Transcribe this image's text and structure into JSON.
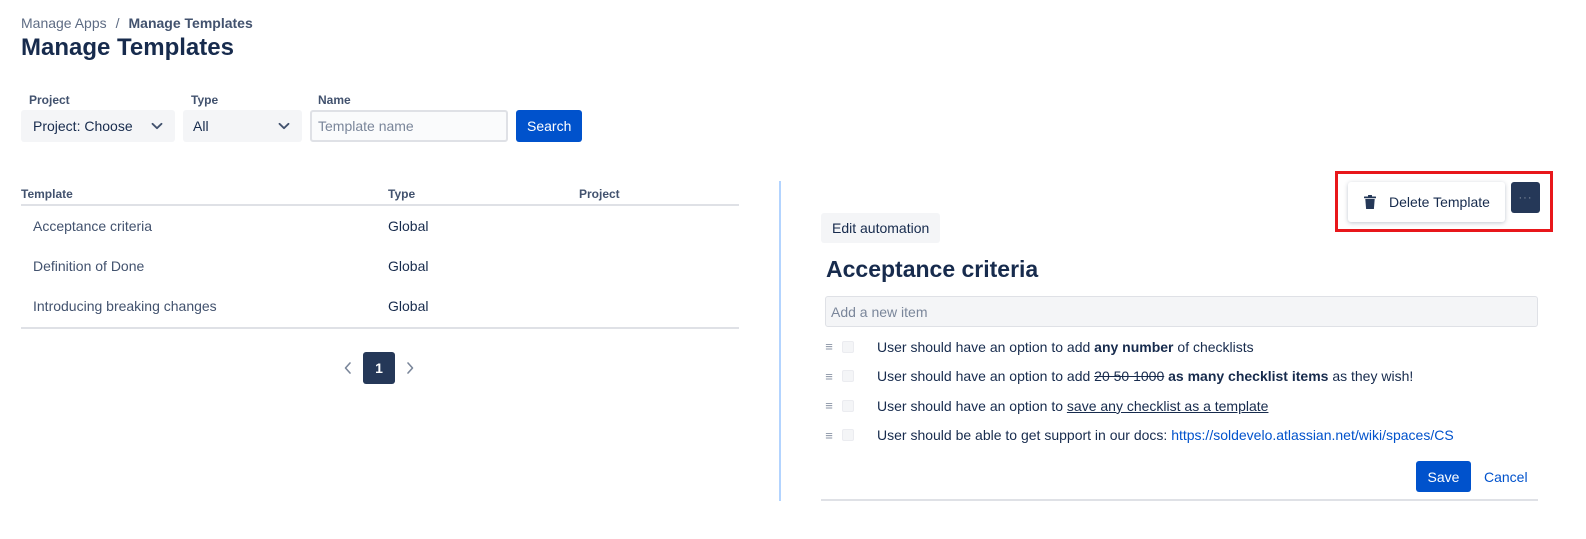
{
  "breadcrumb": {
    "parent": "Manage Apps",
    "separator": "/",
    "current": "Manage Templates"
  },
  "page": {
    "title": "Manage Templates"
  },
  "filters": {
    "project_label": "Project",
    "project_value": "Project: Choose",
    "type_label": "Type",
    "type_value": "All",
    "name_label": "Name",
    "name_placeholder": "Template name",
    "search_label": "Search"
  },
  "table": {
    "columns": [
      "Template",
      "Type",
      "Project"
    ],
    "rows": [
      {
        "name": "Acceptance criteria",
        "type": "Global",
        "project": ""
      },
      {
        "name": "Definition of Done",
        "type": "Global",
        "project": ""
      },
      {
        "name": "Introducing breaking changes",
        "type": "Global",
        "project": ""
      }
    ]
  },
  "pagination": {
    "current": "1"
  },
  "detail": {
    "delete_label": "Delete Template",
    "more_label": "···",
    "edit_automation_label": "Edit automation",
    "title": "Acceptance criteria",
    "add_item_placeholder": "Add a new item",
    "items": [
      {
        "pre": "User should have an option to add ",
        "bold": "any number",
        "post": " of checklists"
      },
      {
        "pre": "User should have an option to add ",
        "strike": "20 50 1000",
        "mid": " ",
        "bold": "as many checklist items",
        "post": " as they wish!"
      },
      {
        "pre": "User should have an option to ",
        "underline": "save any checklist as a template"
      },
      {
        "pre": "User should be able to get support in our docs: ",
        "link": "https://soldevelo.atlassian.net/wiki/spaces/CS"
      }
    ],
    "save_label": "Save",
    "cancel_label": "Cancel"
  },
  "colors": {
    "primary": "#0052cc",
    "dark": "#253858",
    "highlight": "#e8171b",
    "divider": "#b3d4ff"
  }
}
